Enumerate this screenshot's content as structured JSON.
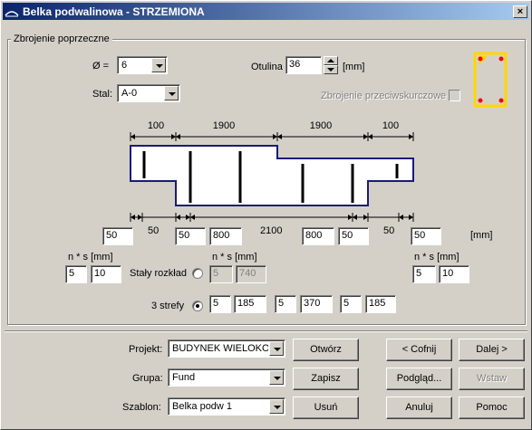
{
  "window": {
    "title": "Belka podwalinowa - STRZEMIONA",
    "close_glyph": "×"
  },
  "group": {
    "caption": "Zbrojenie poprzeczne"
  },
  "diameter": {
    "label": "Ø =",
    "value": "6"
  },
  "steel": {
    "label": "Stal:",
    "value": "A-0"
  },
  "cover": {
    "label": "Otulina",
    "value": "36",
    "unit": "[mm]"
  },
  "anti_shear": {
    "label": "Zbrojenie przeciwskurczowe"
  },
  "top_dims": [
    "100",
    "1900",
    "1900",
    "100"
  ],
  "bottom_dims": [
    "50",
    "2100",
    "50"
  ],
  "bottom_fields": [
    "50",
    "50",
    "800",
    "800",
    "50",
    "50"
  ],
  "units_mm": "[mm]",
  "left_ns": {
    "label": "n * s [mm]",
    "n": "5",
    "s": "10"
  },
  "mid_ns": {
    "label": "n * s [mm]",
    "n": "5",
    "s": "740"
  },
  "right_ns": {
    "label": "n * s [mm]",
    "n": "5",
    "s": "10"
  },
  "constant_spacing": {
    "label": "Stały rozkład"
  },
  "three_zones": {
    "label": "3 strefy",
    "values": [
      "5",
      "185",
      "5",
      "370",
      "5",
      "185"
    ]
  },
  "bottom": {
    "project_label": "Projekt:",
    "project_value": "BUDYNEK WIELOKOND",
    "group_label": "Grupa:",
    "group_value": "Fund",
    "template_label": "Szablon:",
    "template_value": "Belka podw 1"
  },
  "buttons": {
    "open": "Otwórz",
    "save": "Zapisz",
    "delete": "Usuń",
    "back": "< Cofnij",
    "next": "Dalej >",
    "preview": "Podgląd...",
    "insert": "Wstaw",
    "cancel": "Anuluj",
    "help": "Pomoc"
  },
  "colors": {
    "title_start": "#0a246a",
    "title_end": "#a6caf0",
    "beam_outline": "#1a1a7a",
    "section_border": "#ffd700",
    "rebar_dot": "#ff0000"
  }
}
